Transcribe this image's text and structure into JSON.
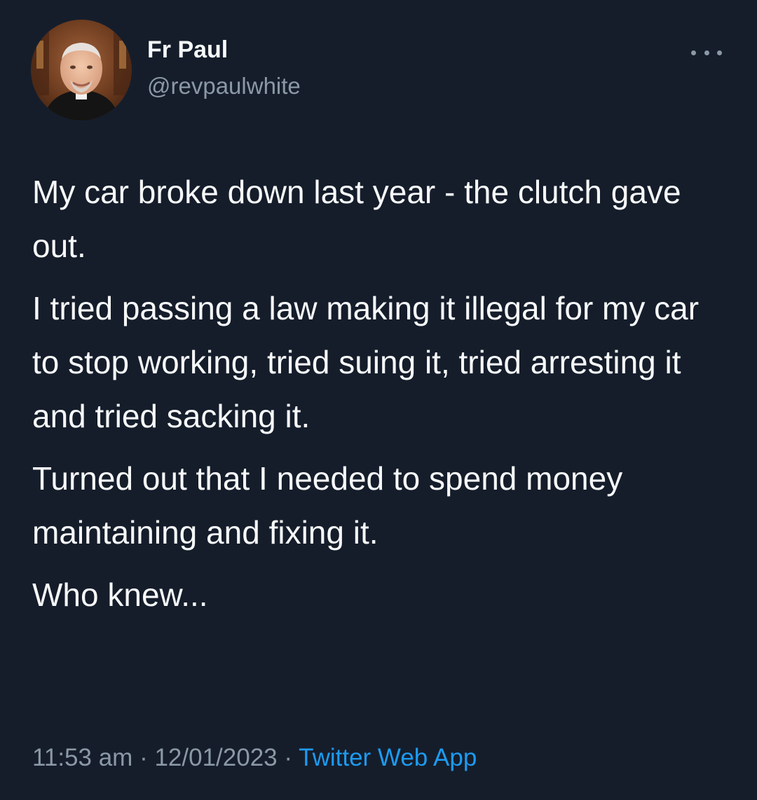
{
  "author": {
    "display_name": "Fr Paul",
    "handle": "@revpaulwhite",
    "avatar_icon": "profile-photo-avatar"
  },
  "more_icon": "more-options-icon",
  "tweet": {
    "paragraphs": [
      "My car broke down last year - the clutch gave out.",
      "I tried passing a law making it illegal for my car to stop working, tried suing it, tried arresting it and tried sacking it.",
      "Turned out that I needed to spend money maintaining and fixing it.",
      "Who knew..."
    ]
  },
  "meta": {
    "time": "11:53 am",
    "separator": "·",
    "date": "12/01/2023",
    "source": "Twitter Web App"
  },
  "colors": {
    "background": "#151d2b",
    "text": "#f7f9f9",
    "secondary_text": "#8b98a5",
    "link": "#1d9bf0"
  }
}
